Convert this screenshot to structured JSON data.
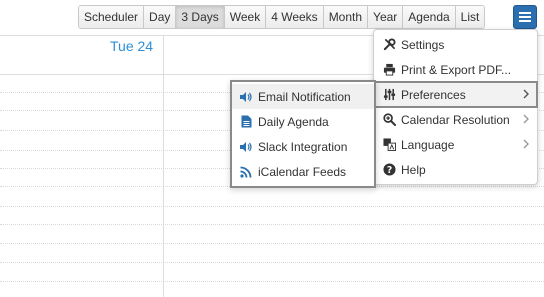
{
  "toolbar": {
    "views": [
      {
        "label": "Scheduler"
      },
      {
        "label": "Day"
      },
      {
        "label": "3 Days",
        "active": true
      },
      {
        "label": "Week"
      },
      {
        "label": "4 Weeks"
      },
      {
        "label": "Month"
      },
      {
        "label": "Year"
      },
      {
        "label": "Agenda"
      },
      {
        "label": "List"
      }
    ],
    "menu_icon": "hamburger-icon",
    "accent_color": "#2a6fb0"
  },
  "calendar": {
    "day_header": "Tue 24",
    "header_color": "#2f8fd6"
  },
  "main_menu": {
    "items": [
      {
        "label": "Settings",
        "icon": "tools-icon"
      },
      {
        "label": "Print & Export PDF...",
        "icon": "printer-icon"
      },
      {
        "label": "Preferences",
        "icon": "sliders-icon",
        "has_submenu": true,
        "highlighted": true
      },
      {
        "label": "Calendar Resolution",
        "icon": "zoom-icon",
        "has_submenu": true
      },
      {
        "label": "Language",
        "icon": "language-icon",
        "has_submenu": true
      },
      {
        "label": "Help",
        "icon": "help-icon"
      }
    ]
  },
  "preferences_menu": {
    "items": [
      {
        "label": "Email Notification",
        "icon": "speaker-icon"
      },
      {
        "label": "Daily Agenda",
        "icon": "document-icon"
      },
      {
        "label": "Slack Integration",
        "icon": "speaker-icon"
      },
      {
        "label": "iCalendar Feeds",
        "icon": "rss-icon"
      }
    ]
  }
}
